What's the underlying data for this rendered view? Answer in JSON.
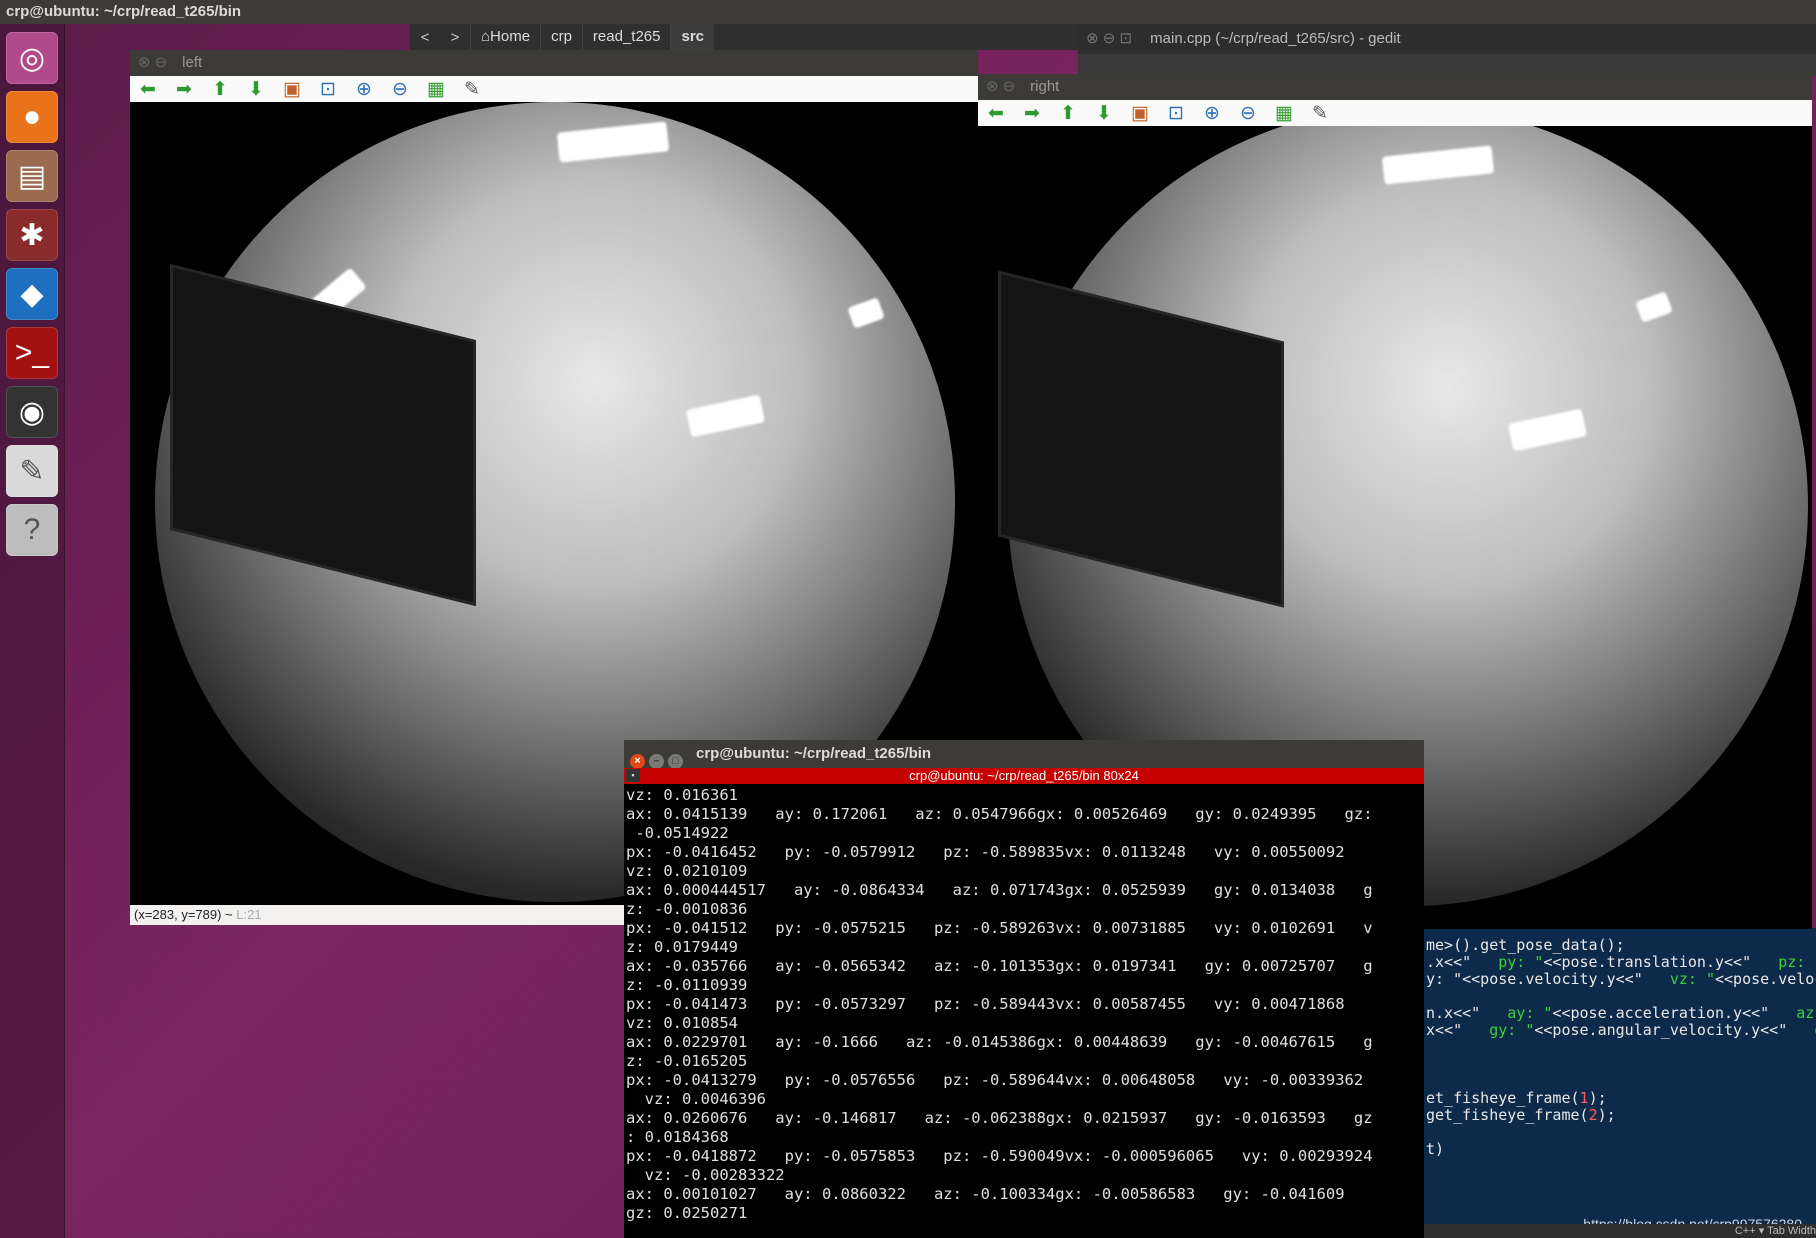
{
  "topbar": {
    "title": "crp@ubuntu: ~/crp/read_t265/bin"
  },
  "launcher": [
    {
      "name": "ubuntu-dash-icon",
      "glyph": "◎",
      "bg": "#b14a8a"
    },
    {
      "name": "firefox-icon",
      "glyph": "●",
      "bg": "#e8731b"
    },
    {
      "name": "files-icon",
      "glyph": "▤",
      "bg": "#9a6b4f"
    },
    {
      "name": "settings-icon",
      "glyph": "✱",
      "bg": "#8a2b2b"
    },
    {
      "name": "vscode-icon",
      "glyph": "◆",
      "bg": "#1f6fc1"
    },
    {
      "name": "terminal-icon",
      "glyph": ">_",
      "bg": "#a31212"
    },
    {
      "name": "camera-icon",
      "glyph": "◉",
      "bg": "#333333"
    },
    {
      "name": "text-editor-icon",
      "glyph": "✎",
      "bg": "#d9d9d9"
    },
    {
      "name": "help-icon",
      "glyph": "?",
      "bg": "#bdbdbd"
    }
  ],
  "pathbar": {
    "home": "⌂Home",
    "crumbs": [
      "crp",
      "read_t265",
      "src"
    ]
  },
  "gedit": {
    "title": "main.cpp (~/crp/read_t265/src) - gedit"
  },
  "left_window": {
    "title": "left",
    "status": "(x=283, y=789) ~ ",
    "status_dim": "L:21"
  },
  "right_window": {
    "title": "right"
  },
  "terminal": {
    "title": "crp@ubuntu: ~/crp/read_t265/bin",
    "subtitle": "crp@ubuntu: ~/crp/read_t265/bin 80x24",
    "lines": [
      "vz: 0.016361",
      "ax: 0.0415139   ay: 0.172061   az: 0.0547966gx: 0.00526469   gy: 0.0249395   gz:",
      " -0.0514922",
      "px: -0.0416452   py: -0.0579912   pz: -0.589835vx: 0.0113248   vy: 0.00550092",
      "vz: 0.0210109",
      "ax: 0.000444517   ay: -0.0864334   az: 0.071743gx: 0.0525939   gy: 0.0134038   g",
      "z: -0.0010836",
      "px: -0.041512   py: -0.0575215   pz: -0.589263vx: 0.00731885   vy: 0.0102691   v",
      "z: 0.0179449",
      "ax: -0.035766   ay: -0.0565342   az: -0.101353gx: 0.0197341   gy: 0.00725707   g",
      "z: -0.0110939",
      "px: -0.041473   py: -0.0573297   pz: -0.589443vx: 0.00587455   vy: 0.00471868",
      "vz: 0.010854",
      "ax: 0.0229701   ay: -0.1666   az: -0.0145386gx: 0.00448639   gy: -0.00467615   g",
      "z: -0.0165205",
      "px: -0.0413279   py: -0.0576556   pz: -0.589644vx: 0.00648058   vy: -0.00339362",
      "  vz: 0.0046396",
      "ax: 0.0260676   ay: -0.146817   az: -0.062388gx: 0.0215937   gy: -0.0163593   gz",
      ": 0.0184368",
      "px: -0.0418872   py: -0.0575853   pz: -0.590049vx: -0.000596065   vy: 0.00293924",
      "  vz: -0.00283322",
      "ax: 0.00101027   ay: 0.0860322   az: -0.100334gx: -0.00586583   gy: -0.041609",
      "gz: 0.0250271"
    ]
  },
  "editor": {
    "lines": [
      {
        "pre": "me>().get_pose_data();",
        "s1": "",
        "mid": "",
        "s2": "",
        "post": ""
      },
      {
        "pre": ".x<<\"   ",
        "s1": "py: \"",
        "mid": "<<pose.translation.y<<\"   ",
        "s2": "pz: \"",
        "post": ""
      },
      {
        "pre": "y: \"",
        "s1": "",
        "mid": "<<pose.velocity.y<<\"   ",
        "s2": "vz: \"",
        "post": "<<pose.veloc"
      },
      {
        "pre": "",
        "s1": "",
        "mid": "",
        "s2": "",
        "post": ""
      },
      {
        "pre": "n.x<<\"   ",
        "s1": "ay: \"",
        "mid": "<<pose.acceleration.y<<\"   ",
        "s2": "az",
        "post": ""
      },
      {
        "pre": "x<<\"   ",
        "s1": "gy: \"",
        "mid": "<<pose.angular_velocity.y<<\"   ",
        "s2": "g",
        "post": ""
      },
      {
        "pre": "",
        "s1": "",
        "mid": "",
        "s2": "",
        "post": ""
      },
      {
        "pre": "",
        "s1": "",
        "mid": "",
        "s2": "",
        "post": ""
      },
      {
        "pre": "",
        "s1": "",
        "mid": "",
        "s2": "",
        "post": ""
      },
      {
        "pre": "et_fisheye_frame(",
        "s1": "",
        "mid": "1",
        "s2": "",
        "post": ");"
      },
      {
        "pre": "get_fisheye_frame(",
        "s1": "",
        "mid": "2",
        "s2": "",
        "post": ");"
      },
      {
        "pre": "",
        "s1": "",
        "mid": "",
        "s2": "",
        "post": ""
      },
      {
        "pre": "t)",
        "s1": "",
        "mid": "",
        "s2": "",
        "post": ""
      }
    ],
    "watermark": "https://blog.csdn.net/crp997576280",
    "status": "C++ ▾   Tab Width"
  }
}
